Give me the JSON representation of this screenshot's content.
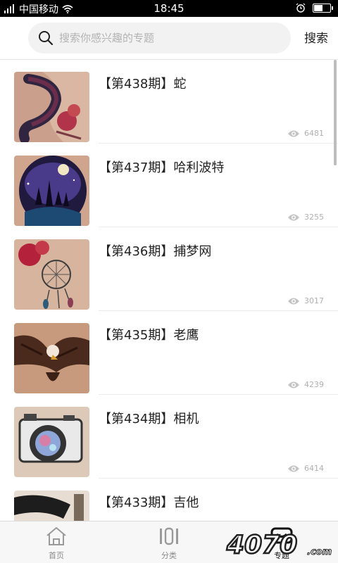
{
  "status_bar": {
    "carrier": "中国移动",
    "time": "18:45",
    "battery_level": 0.55
  },
  "search": {
    "placeholder": "搜索你感兴趣的专题",
    "button_label": "搜索"
  },
  "topics": [
    {
      "title": "【第438期】蛇",
      "views": "6481"
    },
    {
      "title": "【第437期】哈利波特",
      "views": "3255"
    },
    {
      "title": "【第436期】捕梦网",
      "views": "3017"
    },
    {
      "title": "【第435期】老鹰",
      "views": "4239"
    },
    {
      "title": "【第434期】相机",
      "views": "6414"
    },
    {
      "title": "【第433期】吉他",
      "views": ""
    }
  ],
  "bottom_nav": [
    {
      "label": "首页",
      "icon": "home-icon",
      "active": false
    },
    {
      "label": "分类",
      "icon": "category-icon",
      "active": false
    },
    {
      "label": "专题",
      "icon": "topic-icon",
      "active": true
    }
  ],
  "watermark_text": "4070.com",
  "colors": {
    "status_bar": "#000000",
    "search_bg": "#f2f2f2",
    "muted_text": "#b0b0b0",
    "nav_bg": "#f7f7f7"
  }
}
